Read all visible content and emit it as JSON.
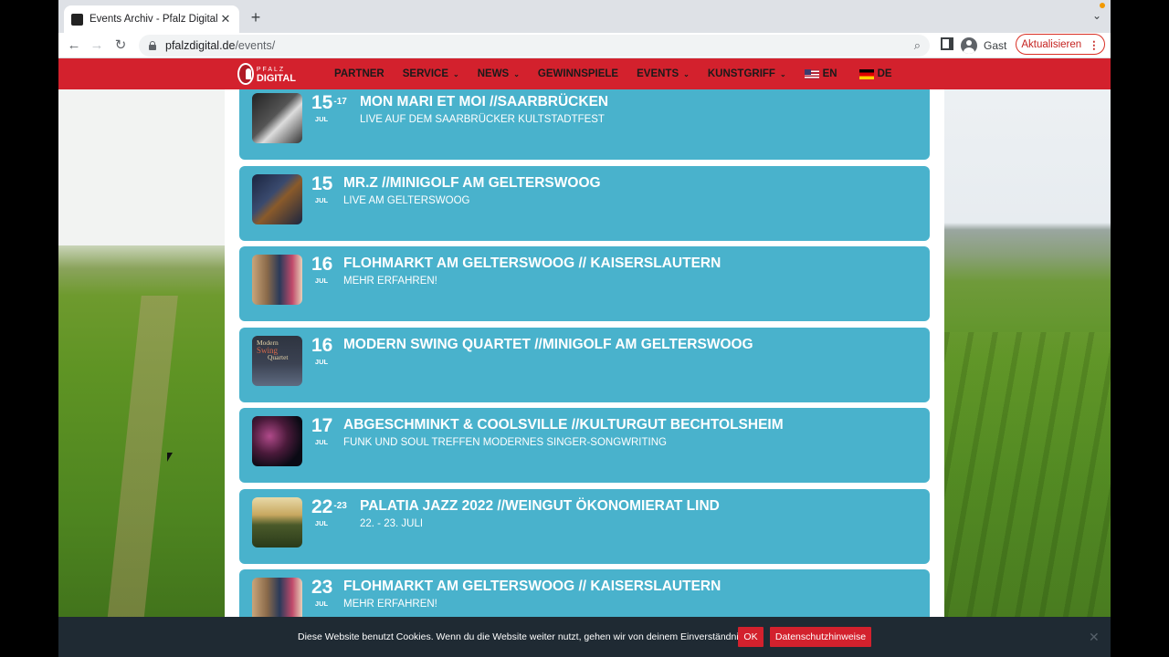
{
  "browser": {
    "tab_title": "Events Archiv - Pfalz Digital - I",
    "tab_close": "✕",
    "new_tab": "+",
    "tab_menu": "⌄",
    "url_host": "pfalzdigital.de",
    "url_path": "/events/",
    "profile_label": "Gast",
    "update_label": "Aktualisieren",
    "update_dots": "⋮",
    "back": "←",
    "forward": "→",
    "reload": "↻",
    "zoom_icon": "⌕"
  },
  "site": {
    "logo_top": "PFALZ",
    "logo_bottom": "DIGITAL",
    "nav": [
      {
        "label": "PARTNER",
        "has_dropdown": false
      },
      {
        "label": "SERVICE",
        "has_dropdown": true
      },
      {
        "label": "NEWS",
        "has_dropdown": true
      },
      {
        "label": "GEWINNSPIELE",
        "has_dropdown": false
      },
      {
        "label": "EVENTS",
        "has_dropdown": true
      },
      {
        "label": "KUNSTGRIFF",
        "has_dropdown": true
      }
    ],
    "chevron": "⌄",
    "lang_en": "EN",
    "lang_de": "DE"
  },
  "events": [
    {
      "day": "15",
      "day_end": "-17",
      "month": "JUL",
      "title": "MON MARI ET MOI //SAARBRÜCKEN",
      "subtitle": "LIVE AUF DEM SAARBRÜCKER KULTSTADTFEST"
    },
    {
      "day": "15",
      "day_end": "",
      "month": "JUL",
      "title": "MR.Z //MINIGOLF AM GELTERSWOOG",
      "subtitle": "LIVE AM GELTERSWOOG"
    },
    {
      "day": "16",
      "day_end": "",
      "month": "JUL",
      "title": "FLOHMARKT AM GELTERSWOOG // KAISERSLAUTERN",
      "subtitle": "MEHR ERFAHREN!"
    },
    {
      "day": "16",
      "day_end": "",
      "month": "JUL",
      "title": "MODERN SWING QUARTET //MINIGOLF AM GELTERSWOOG",
      "subtitle": "",
      "thumb_text": [
        "Modern",
        "Swing",
        "Quartet"
      ]
    },
    {
      "day": "17",
      "day_end": "",
      "month": "JUL",
      "title": "ABGESCHMINKT & COOLSVILLE //KULTURGUT BECHTOLSHEIM",
      "subtitle": "FUNK UND SOUL TREFFEN MODERNES SINGER-SONGWRITING"
    },
    {
      "day": "22",
      "day_end": "-23",
      "month": "JUL",
      "title": "PALATIA JAZZ 2022 //WEINGUT ÖKONOMIERAT LIND",
      "subtitle": "22. - 23. JULI"
    },
    {
      "day": "23",
      "day_end": "",
      "month": "JUL",
      "title": "FLOHMARKT AM GELTERSWOOG // KAISERSLAUTERN",
      "subtitle": "MEHR ERFAHREN!"
    }
  ],
  "cookie": {
    "text": "Diese Website benutzt Cookies. Wenn du die Website weiter nutzt, gehen wir von deinem Einverständnis aus.",
    "ok": "OK",
    "privacy": "Datenschutzhinweise",
    "close": "✕"
  },
  "colors": {
    "brand_red": "#d3212d",
    "card_blue": "#49b2cc",
    "cookie_bg": "#1f2a33"
  }
}
